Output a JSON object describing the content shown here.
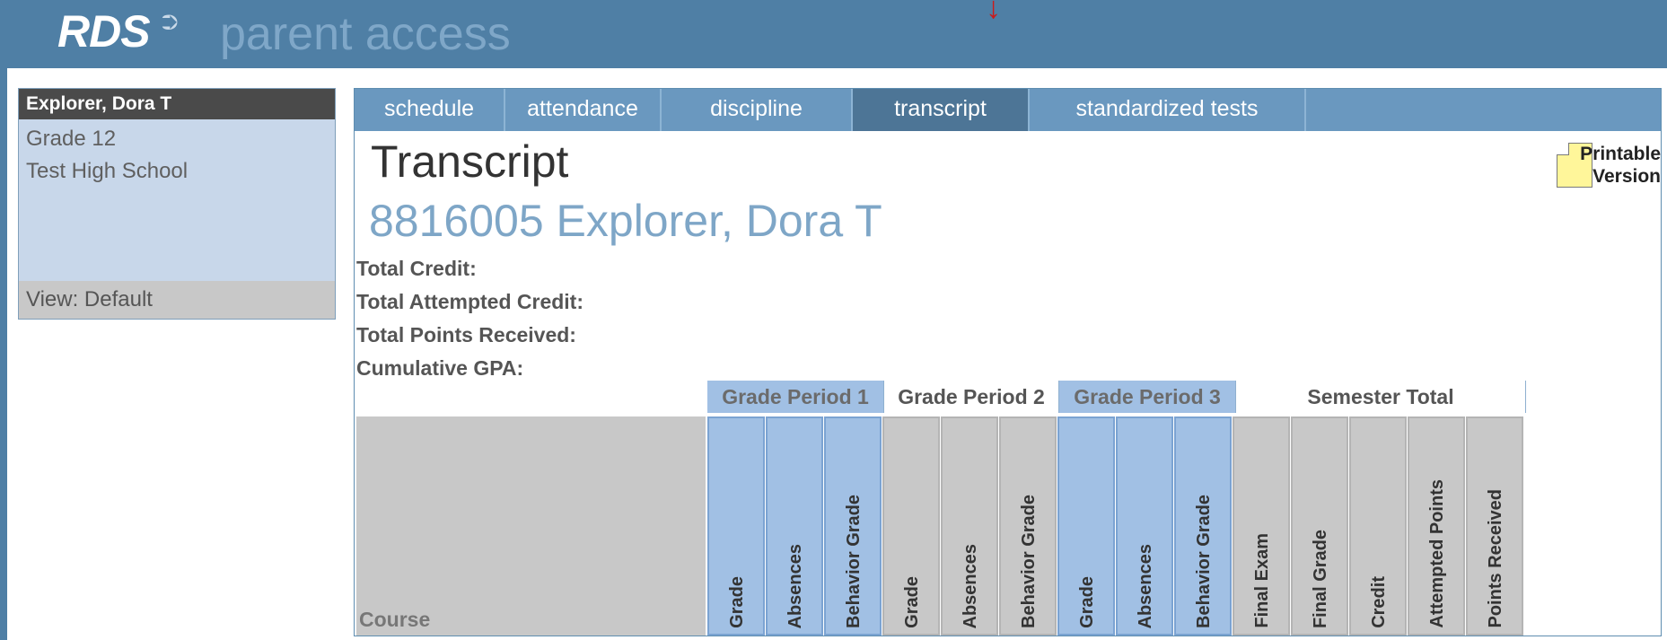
{
  "header": {
    "logo_text": "RDS",
    "logo_mark": "⮊",
    "subtitle": "parent access",
    "arrow": "↓",
    "colors": {
      "bar": "#4f7fa5",
      "accent": "#7ea6c7"
    }
  },
  "student": {
    "name": "Explorer, Dora T",
    "grade": "Grade 12",
    "school": "Test High School",
    "view": "View: Default"
  },
  "tabs": [
    {
      "label": "schedule",
      "active": false
    },
    {
      "label": "attendance",
      "active": false
    },
    {
      "label": "discipline",
      "active": false
    },
    {
      "label": "transcript",
      "active": true
    },
    {
      "label": "standardized tests",
      "active": false
    }
  ],
  "page": {
    "title": "Transcript",
    "student_heading": "8816005 Explorer, Dora T",
    "print_label": "Printable Version",
    "print_icon": "document-icon"
  },
  "summary": {
    "total_credit": "Total Credit:",
    "total_attempted_credit": "Total Attempted Credit:",
    "total_points_received": "Total Points Received:",
    "cumulative_gpa": "Cumulative GPA:"
  },
  "table": {
    "course_label": "Course",
    "periods": [
      {
        "name": "Grade Period 1",
        "columns": [
          "Grade",
          "Absences",
          "Behavior Grade"
        ]
      },
      {
        "name": "Grade Period 2",
        "columns": [
          "Grade",
          "Absences",
          "Behavior Grade"
        ]
      },
      {
        "name": "Grade Period 3",
        "columns": [
          "Grade",
          "Absences",
          "Behavior Grade"
        ]
      },
      {
        "name": "Semester Total",
        "columns": [
          "Final Exam",
          "Final Grade",
          "Credit",
          "Attempted Points",
          "Points Received"
        ]
      }
    ]
  }
}
